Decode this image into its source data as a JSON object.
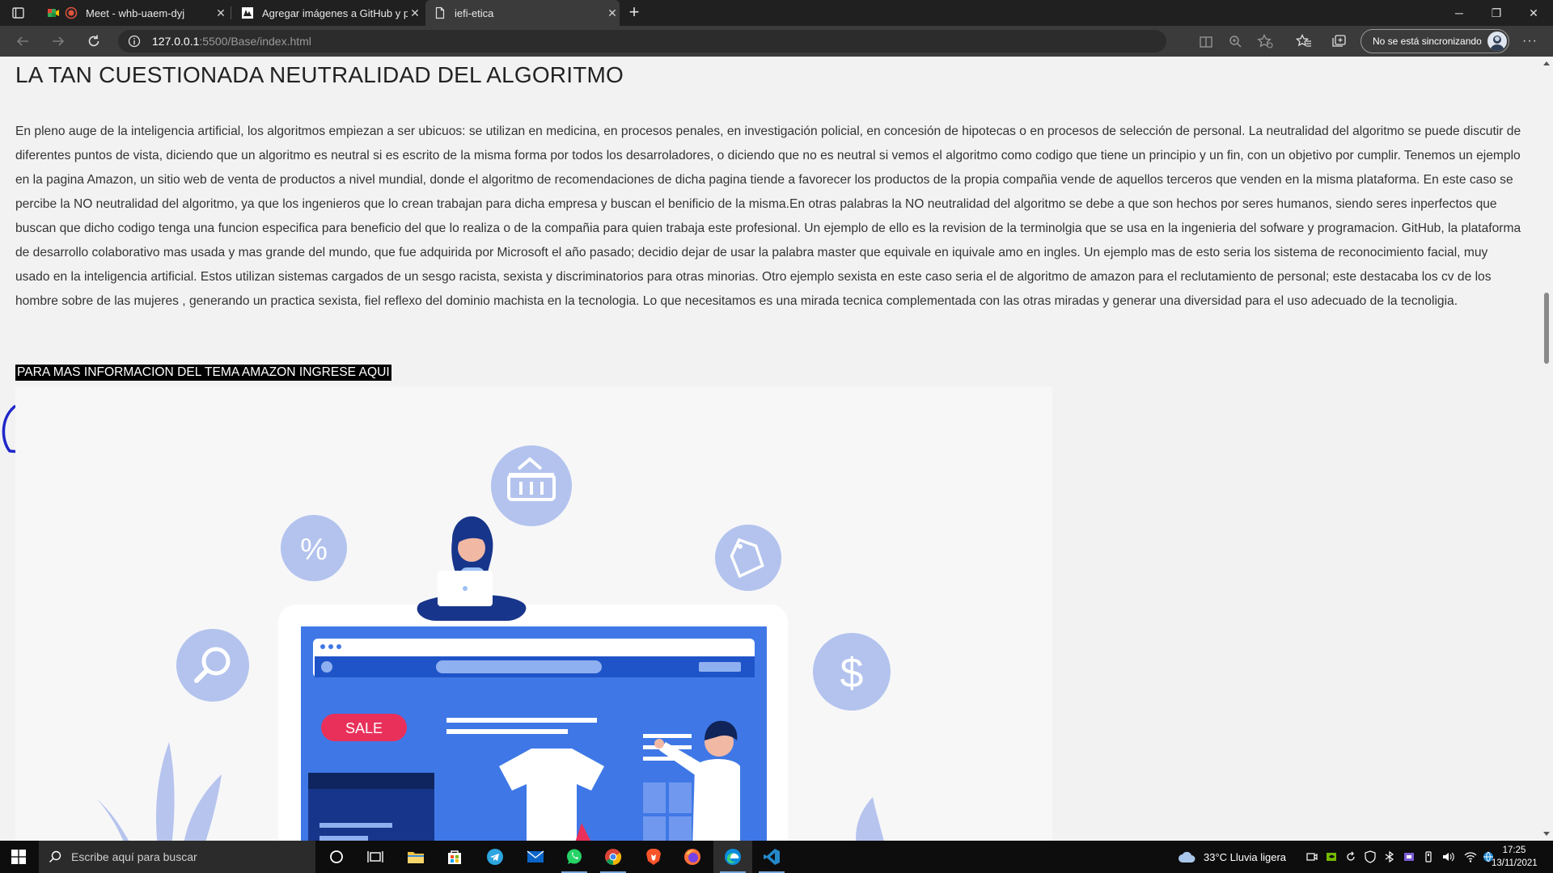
{
  "browser": {
    "tabs": [
      {
        "title": "Meet - whb-uaem-dyj",
        "close": "✕"
      },
      {
        "title": "Agregar imágenes a GitHub y po",
        "close": "✕"
      },
      {
        "title": "iefi-etica",
        "close": "✕"
      }
    ],
    "new_tab": "+",
    "window_controls": {
      "minimize": "─",
      "restore": "❐",
      "close": "✕"
    },
    "url_host": "127.0.0.1",
    "url_rest": ":5500/Base/index.html",
    "sync_label": "No se está sincronizando",
    "more_label": "···"
  },
  "page": {
    "title": "LA TAN CUESTIONADA NEUTRALIDAD DEL ALGORITMO",
    "paragraph": "En pleno auge de la inteligencia artificial, los algoritmos empiezan a ser ubicuos: se utilizan en medicina, en procesos penales, en investigación policial, en concesión de hipotecas o en procesos de selección de personal. La neutralidad del algoritmo se puede discutir de diferentes puntos de vista, diciendo que un algoritmo es neutral si es escrito de la misma forma por todos los desarroladores, o diciendo que no es neutral si vemos el algoritmo como codigo que tiene un principio y un fin, con un objetivo por cumplir. Tenemos un ejemplo en la pagina Amazon, un sitio web de venta de productos a nivel mundial, donde el algoritmo de recomendaciones de dicha pagina tiende a favorecer los productos de la propia compañia vende de aquellos terceros que venden en la misma plataforma. En este caso se percibe la NO neutralidad del algoritmo, ya que los ingenieros que lo crean trabajan para dicha empresa y buscan el benificio de la misma.En otras palabras la NO neutralidad del algoritmo se debe a que son hechos por seres humanos, siendo seres inperfectos que buscan que dicho codigo tenga una funcion especifica para beneficio del que lo realiza o de la compañia para quien trabaja este profesional. Un ejemplo de ello es la revision de la terminolgia que se usa en la ingenieria del sofware y programacion. GitHub, la plataforma de desarrollo colaborativo mas usada y mas grande del mundo, que fue adquirida por Microsoft el año pasado; decidio dejar de usar la palabra master que equivale en iquivale amo en ingles. Un ejemplo mas de esto seria los sistema de reconocimiento facial, muy usado en la inteligencia artificial. Estos utilizan sistemas cargados de un sesgo racista, sexista y discriminatorios para otras minorias. Otro ejemplo sexista en este caso seria el de algoritmo de amazon para el reclutamiento de personal; este destacaba los cv de los hombre sobre de las mujeres , generando un practica sexista, fiel reflexo del dominio machista en la tecnologia. Lo que necesitamos es una mirada tecnica complementada con las otras miradas y generar una diversidad para el uso adecuado de la tecnoligia.",
    "link_text": "PARA MAS INFORMACION DEL TEMA AMAZON INGRESE AQUI",
    "illustration": {
      "sale_badge": "SALE",
      "percent_symbol": "%",
      "dollar_symbol": "$"
    }
  },
  "taskbar": {
    "search_placeholder": "Escribe aquí para buscar",
    "weather": "33°C  Lluvia ligera",
    "time": "17:25",
    "date": "13/11/2021"
  }
}
